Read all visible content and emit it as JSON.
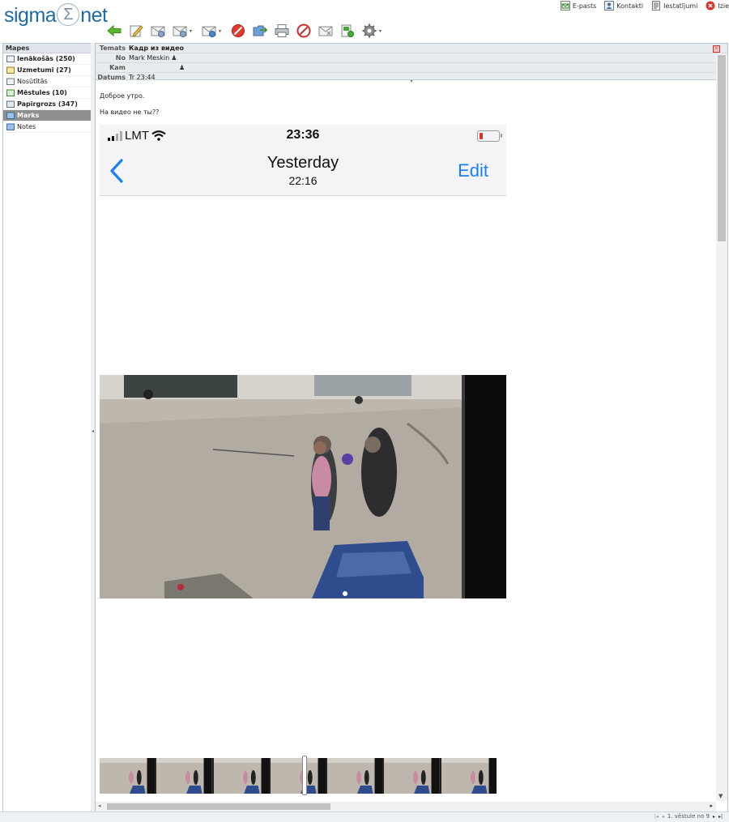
{
  "app": {
    "logo_left": "sigma",
    "logo_mid": "Σ",
    "logo_right": "net"
  },
  "toplinks": [
    {
      "label": "E-pasts",
      "icon": "mail-icon"
    },
    {
      "label": "Kontakti",
      "icon": "contacts-icon"
    },
    {
      "label": "Iestatījumi",
      "icon": "settings-icon"
    },
    {
      "label": "Izie",
      "icon": "logout-icon"
    }
  ],
  "toolbar": [
    "back-arrow-icon",
    "compose-icon",
    "reply-icon",
    "reply-all-icon",
    "forward-icon",
    "delete-icon",
    "move-icon",
    "print-icon",
    "spam-icon",
    "mark-icon",
    "flag-icon",
    "gear-icon"
  ],
  "folders": {
    "title": "Mapes",
    "items": [
      {
        "label": "Ienākošās (250)",
        "icon": "inbox-icon",
        "bold": true,
        "active": false
      },
      {
        "label": "Uzmetumi (27)",
        "icon": "drafts-icon",
        "bold": true,
        "active": false
      },
      {
        "label": "Nosūtītās",
        "icon": "sent-icon",
        "bold": false,
        "active": false
      },
      {
        "label": "Mēstules (10)",
        "icon": "junk-icon",
        "bold": true,
        "active": false
      },
      {
        "label": "Papīrgrozs (347)",
        "icon": "trash-icon",
        "bold": true,
        "active": false
      },
      {
        "label": "Marks",
        "icon": "folder-icon",
        "bold": true,
        "active": true
      },
      {
        "label": "Notes",
        "icon": "folder-icon",
        "bold": false,
        "active": false
      }
    ]
  },
  "message": {
    "subject_label": "Temats",
    "subject": "Кадр из видео",
    "from_label": "No",
    "from": "Mark Meskin",
    "to_label": "Kam",
    "to": "",
    "date_label": "Datums",
    "date": "Tr 23:44",
    "body_lines": [
      "Доброе утро.",
      "На видео не ты??"
    ]
  },
  "phone": {
    "carrier": "LMT",
    "time": "23:36",
    "nav_title": "Yesterday",
    "nav_subtitle": "22:16",
    "edit_label": "Edit",
    "accent": "#1a7ff5",
    "battery_color": "#e0302a"
  },
  "pager": {
    "text": "1. vēstule no 9"
  }
}
